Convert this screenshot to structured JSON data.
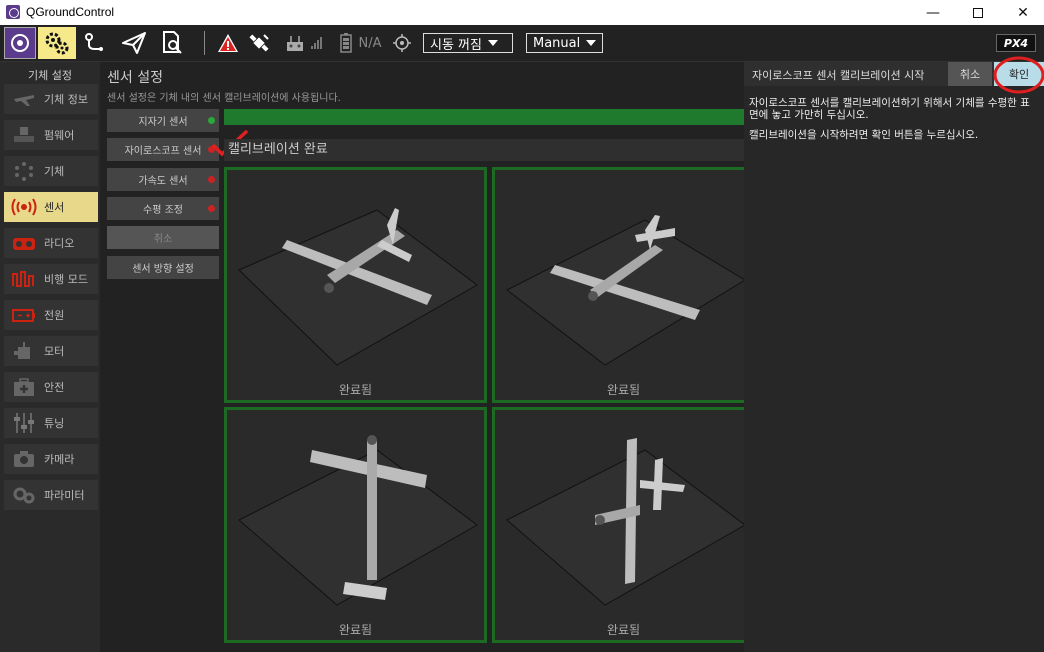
{
  "window": {
    "title": "QGroundControl"
  },
  "toolbar": {
    "signal_text": "N/A",
    "arm_label": "시동 꺼짐",
    "mode_label": "Manual",
    "brand": "PX4"
  },
  "sidebar": {
    "header": "기체 설정",
    "items": [
      {
        "label": "기체 정보"
      },
      {
        "label": "펌웨어"
      },
      {
        "label": "기체"
      },
      {
        "label": "센서"
      },
      {
        "label": "라디오"
      },
      {
        "label": "비행 모드"
      },
      {
        "label": "전원"
      },
      {
        "label": "모터"
      },
      {
        "label": "안전"
      },
      {
        "label": "튜닝"
      },
      {
        "label": "카메라"
      },
      {
        "label": "파라미터"
      }
    ]
  },
  "main": {
    "title": "센서 설정",
    "description": "센서 설정은 기체 내의 센서 캘리브레이션에 사용됩니다.",
    "sensor_buttons": [
      {
        "label": "지자기 센서",
        "status": "green"
      },
      {
        "label": "자이로스코프 센서",
        "status": "red"
      },
      {
        "label": "가속도 센서",
        "status": "red"
      },
      {
        "label": "수평 조정",
        "status": "red"
      },
      {
        "label": "취소"
      },
      {
        "label": "센서 방향 설정"
      }
    ],
    "progress": 1.0,
    "calibration_header": "캘리브레이션 완료",
    "panels": [
      {
        "caption": "완료됨"
      },
      {
        "caption": "완료됨"
      },
      {
        "caption": "완료됨"
      },
      {
        "caption": "완료됨"
      }
    ]
  },
  "right_panel": {
    "title": "자이로스코프 센서 캘리브레이션 시작",
    "cancel_label": "취소",
    "ok_label": "확인",
    "line1": "자이로스코프 센서를 캘리브레이션하기 위해서 기체를 수평한 표면에 놓고 가만히 두십시오.",
    "line2": "캘리브레이션을 시작하려면 확인 버튼을 누르십시오."
  },
  "colors": {
    "accent": "#e8d88a",
    "ok_button": "#b8dce8",
    "progress": "#1f7a2e",
    "annotation": "#e02020"
  }
}
